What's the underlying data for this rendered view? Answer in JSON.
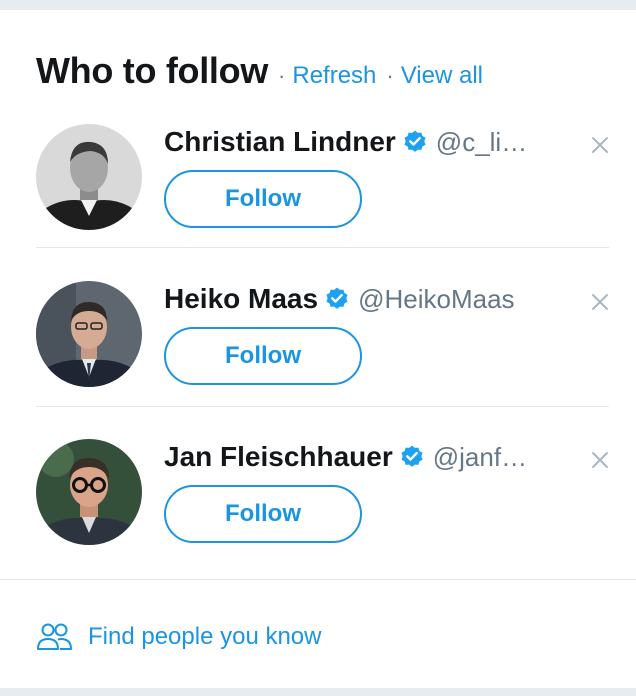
{
  "header": {
    "title": "Who to follow",
    "separator": "·",
    "refresh_label": "Refresh",
    "view_all_label": "View all"
  },
  "users": [
    {
      "name": "Christian Lindner",
      "handle": "@c_li…",
      "verified": true,
      "follow_label": "Follow",
      "dismiss": "×"
    },
    {
      "name": "Heiko Maas",
      "handle": "@HeikoMaas",
      "verified": true,
      "follow_label": "Follow",
      "dismiss": "×"
    },
    {
      "name": "Jan Fleischhauer",
      "handle": "@janf…",
      "verified": true,
      "follow_label": "Follow",
      "dismiss": "×"
    }
  ],
  "footer": {
    "icon": "people-icon",
    "label": "Find people you know"
  },
  "colors": {
    "accent": "#1b95e0",
    "text": "#14171a",
    "muted": "#657786",
    "divider": "#e1e8ed"
  }
}
